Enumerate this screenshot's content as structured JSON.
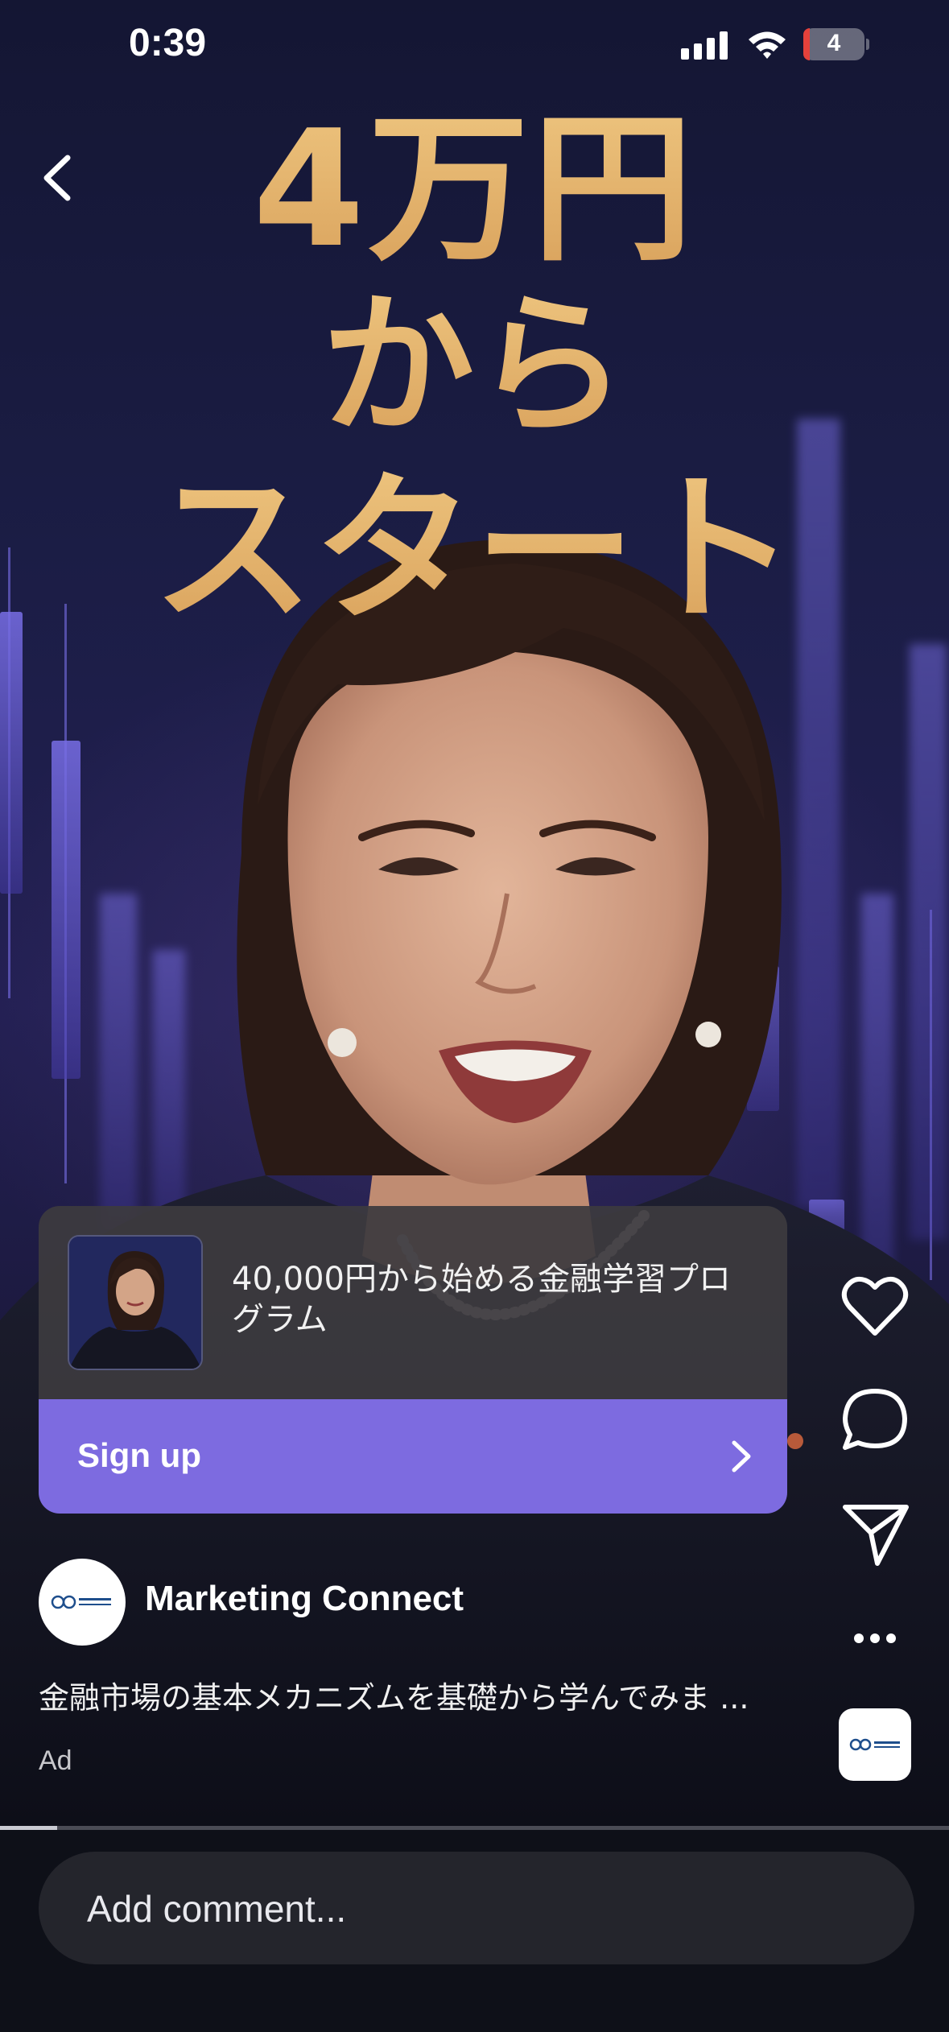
{
  "status_bar": {
    "time": "0:39",
    "battery_level": "4",
    "icons": [
      "signal-icon",
      "wifi-icon",
      "battery-icon"
    ]
  },
  "ad_creative": {
    "headline_line1": "4万円",
    "headline_line2": "から",
    "headline_line3": "スタート",
    "headline_color": "#e6b66e"
  },
  "ad_card": {
    "title": "40,000円から始める金融学習プログラム",
    "cta_label": "Sign up",
    "cta_color": "#7d6be0"
  },
  "post": {
    "advertiser": "Marketing Connect",
    "caption": "金融市場の基本メカニズムを基礎から学んでみま ...",
    "ad_label": "Ad"
  },
  "actions": {
    "icons": [
      "heart-icon",
      "comment-icon",
      "share-icon",
      "more-icon"
    ]
  },
  "video_progress_fraction": 0.06,
  "comment_bar": {
    "placeholder": "Add comment..."
  }
}
